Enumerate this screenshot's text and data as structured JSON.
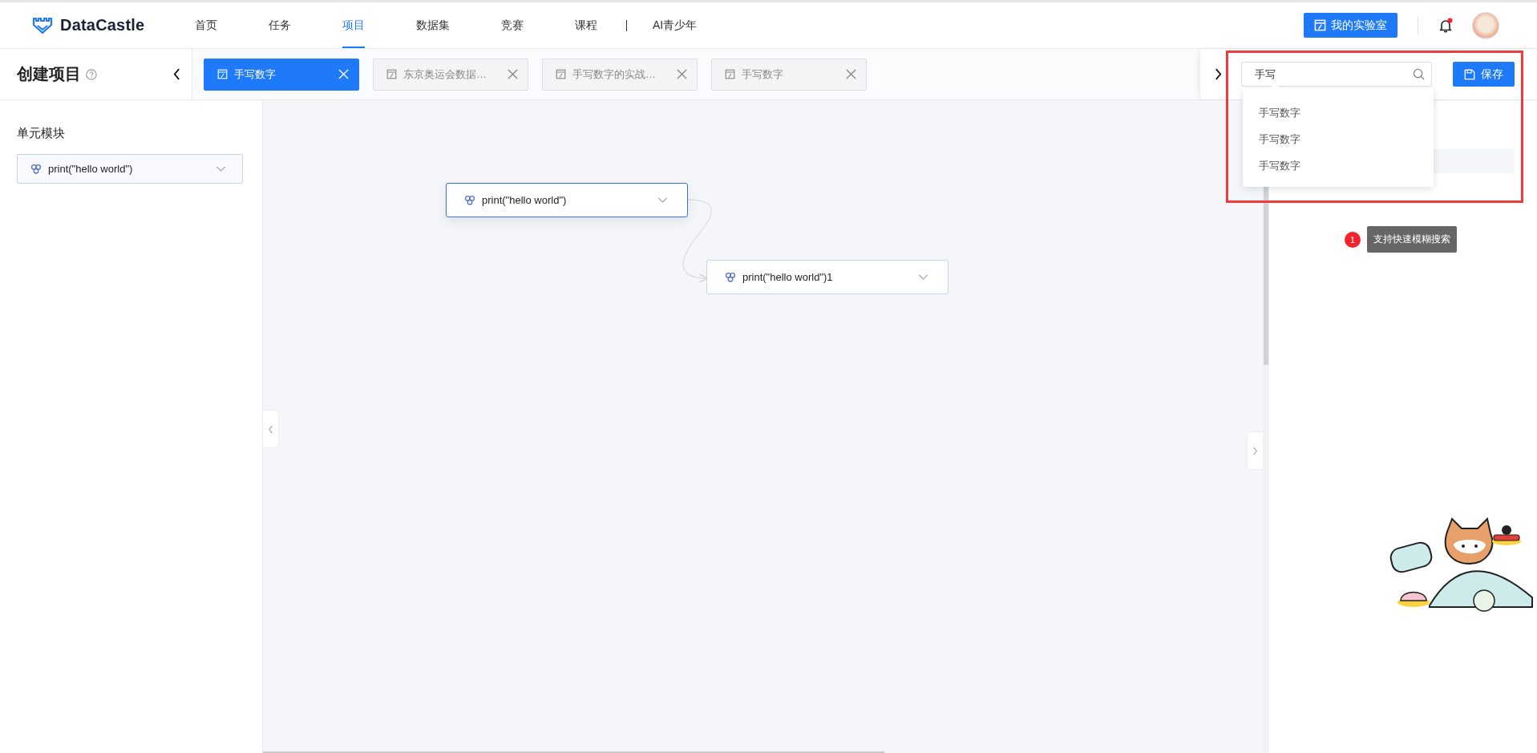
{
  "logo": {
    "text": "DataCastle"
  },
  "nav": [
    {
      "label": "首页",
      "selected": false
    },
    {
      "label": "任务",
      "selected": false
    },
    {
      "label": "项目",
      "selected": true
    },
    {
      "label": "数据集",
      "selected": false
    },
    {
      "label": "竞赛",
      "selected": false
    },
    {
      "label": "课程",
      "selected": false
    },
    {
      "label": "AI青少年",
      "selected": false
    }
  ],
  "lab_button": {
    "label": "我的实验室"
  },
  "notifications": {
    "unread": true
  },
  "page_title": "创建项目",
  "tabs": [
    {
      "label": "手写数字",
      "selected": true
    },
    {
      "label": "东京奥运会数据…",
      "selected": false
    },
    {
      "label": "手写数字的实战…",
      "selected": false
    },
    {
      "label": "手写数字",
      "selected": false
    }
  ],
  "search": {
    "value": "手写",
    "suggestions": [
      "手写数字",
      "手写数字",
      "手写数字"
    ]
  },
  "save_button": {
    "label": "保存"
  },
  "sidebar": {
    "title": "单元模块",
    "module": {
      "label": "print(\"hello world\")"
    }
  },
  "canvas": {
    "nodes": [
      {
        "label": "print(\"hello world\")",
        "selected": true
      },
      {
        "label": "print(\"hello world\")1",
        "selected": false
      }
    ]
  },
  "tooltip": {
    "badge": "1",
    "text": "支持快速模糊搜索"
  }
}
